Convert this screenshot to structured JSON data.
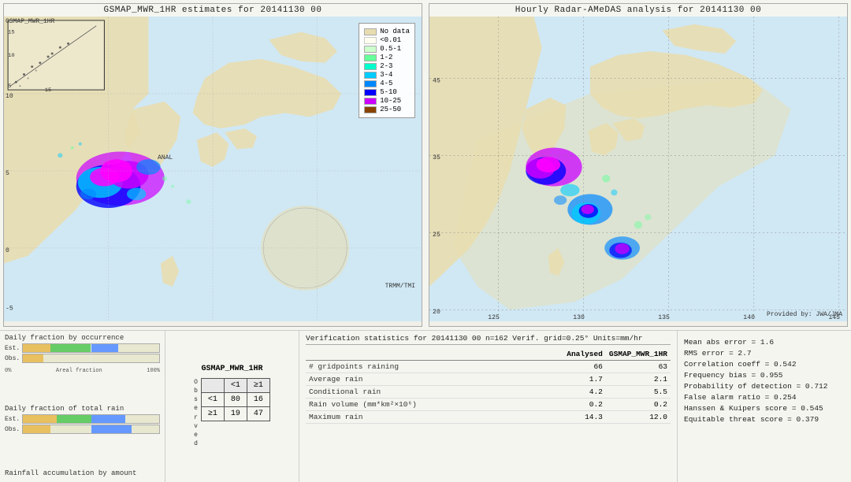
{
  "leftMap": {
    "title": "GSMAP_MWR_1HR estimates for 20141130 00",
    "gsmap_label": "GSMAP_MWR_1HR",
    "anal_label": "ANAL",
    "trmm_label": "TRMM/TMI"
  },
  "rightMap": {
    "title": "Hourly Radar-AMeDAS analysis for 20141130 00",
    "provided_label": "Provided by: JWA/JMA"
  },
  "legend": {
    "title": "",
    "items": [
      {
        "label": "No data",
        "color": "#e8e0b0"
      },
      {
        "label": "<0.01",
        "color": "#fffff0"
      },
      {
        "label": "0.5-1",
        "color": "#ccffcc"
      },
      {
        "label": "1-2",
        "color": "#66ff99"
      },
      {
        "label": "2-3",
        "color": "#00ffcc"
      },
      {
        "label": "3-4",
        "color": "#00ccff"
      },
      {
        "label": "4-5",
        "color": "#0088ff"
      },
      {
        "label": "5-10",
        "color": "#0000ff"
      },
      {
        "label": "10-25",
        "color": "#cc00ff"
      },
      {
        "label": "25-50",
        "color": "#884400"
      }
    ]
  },
  "charts": {
    "occurrence_title": "Daily fraction by occurrence",
    "rain_title": "Daily fraction of total rain",
    "accumulation_title": "Rainfall accumulation by amount",
    "est_label": "Est.",
    "obs_label": "Obs.",
    "axis_start": "0%",
    "axis_end": "100%",
    "axis_mid": "Areal fraction"
  },
  "contingency": {
    "title": "GSMAP_MWR_1HR",
    "col_lt1": "<1",
    "col_ge1": "≥1",
    "row_lt1": "<1",
    "row_ge1": "≥1",
    "observed_label": "O\nb\ns\ne\nr\nv\ne\nd",
    "val_a": "80",
    "val_b": "16",
    "val_c": "19",
    "val_d": "47"
  },
  "verification": {
    "title": "Verification statistics for 20141130 00  n=162  Verif. grid=0.25°  Units=mm/hr",
    "col_header_analysed": "Analysed",
    "col_header_gsmap": "GSMAP_MWR_1HR",
    "rows": [
      {
        "label": "# gridpoints raining",
        "analysed": "66",
        "gsmap": "63"
      },
      {
        "label": "Average rain",
        "analysed": "1.7",
        "gsmap": "2.1"
      },
      {
        "label": "Conditional rain",
        "analysed": "4.2",
        "gsmap": "5.5"
      },
      {
        "label": "Rain volume (mm*km²×10⁶)",
        "analysed": "0.2",
        "gsmap": "0.2"
      },
      {
        "label": "Maximum rain",
        "analysed": "14.3",
        "gsmap": "12.0"
      }
    ]
  },
  "metrics": {
    "items": [
      "Mean abs error = 1.6",
      "RMS error = 2.7",
      "Correlation coeff = 0.542",
      "Frequency bias = 0.955",
      "Probability of detection = 0.712",
      "False alarm ratio = 0.254",
      "Hanssen & Kuipers score = 0.545",
      "Equitable threat score = 0.379"
    ]
  }
}
